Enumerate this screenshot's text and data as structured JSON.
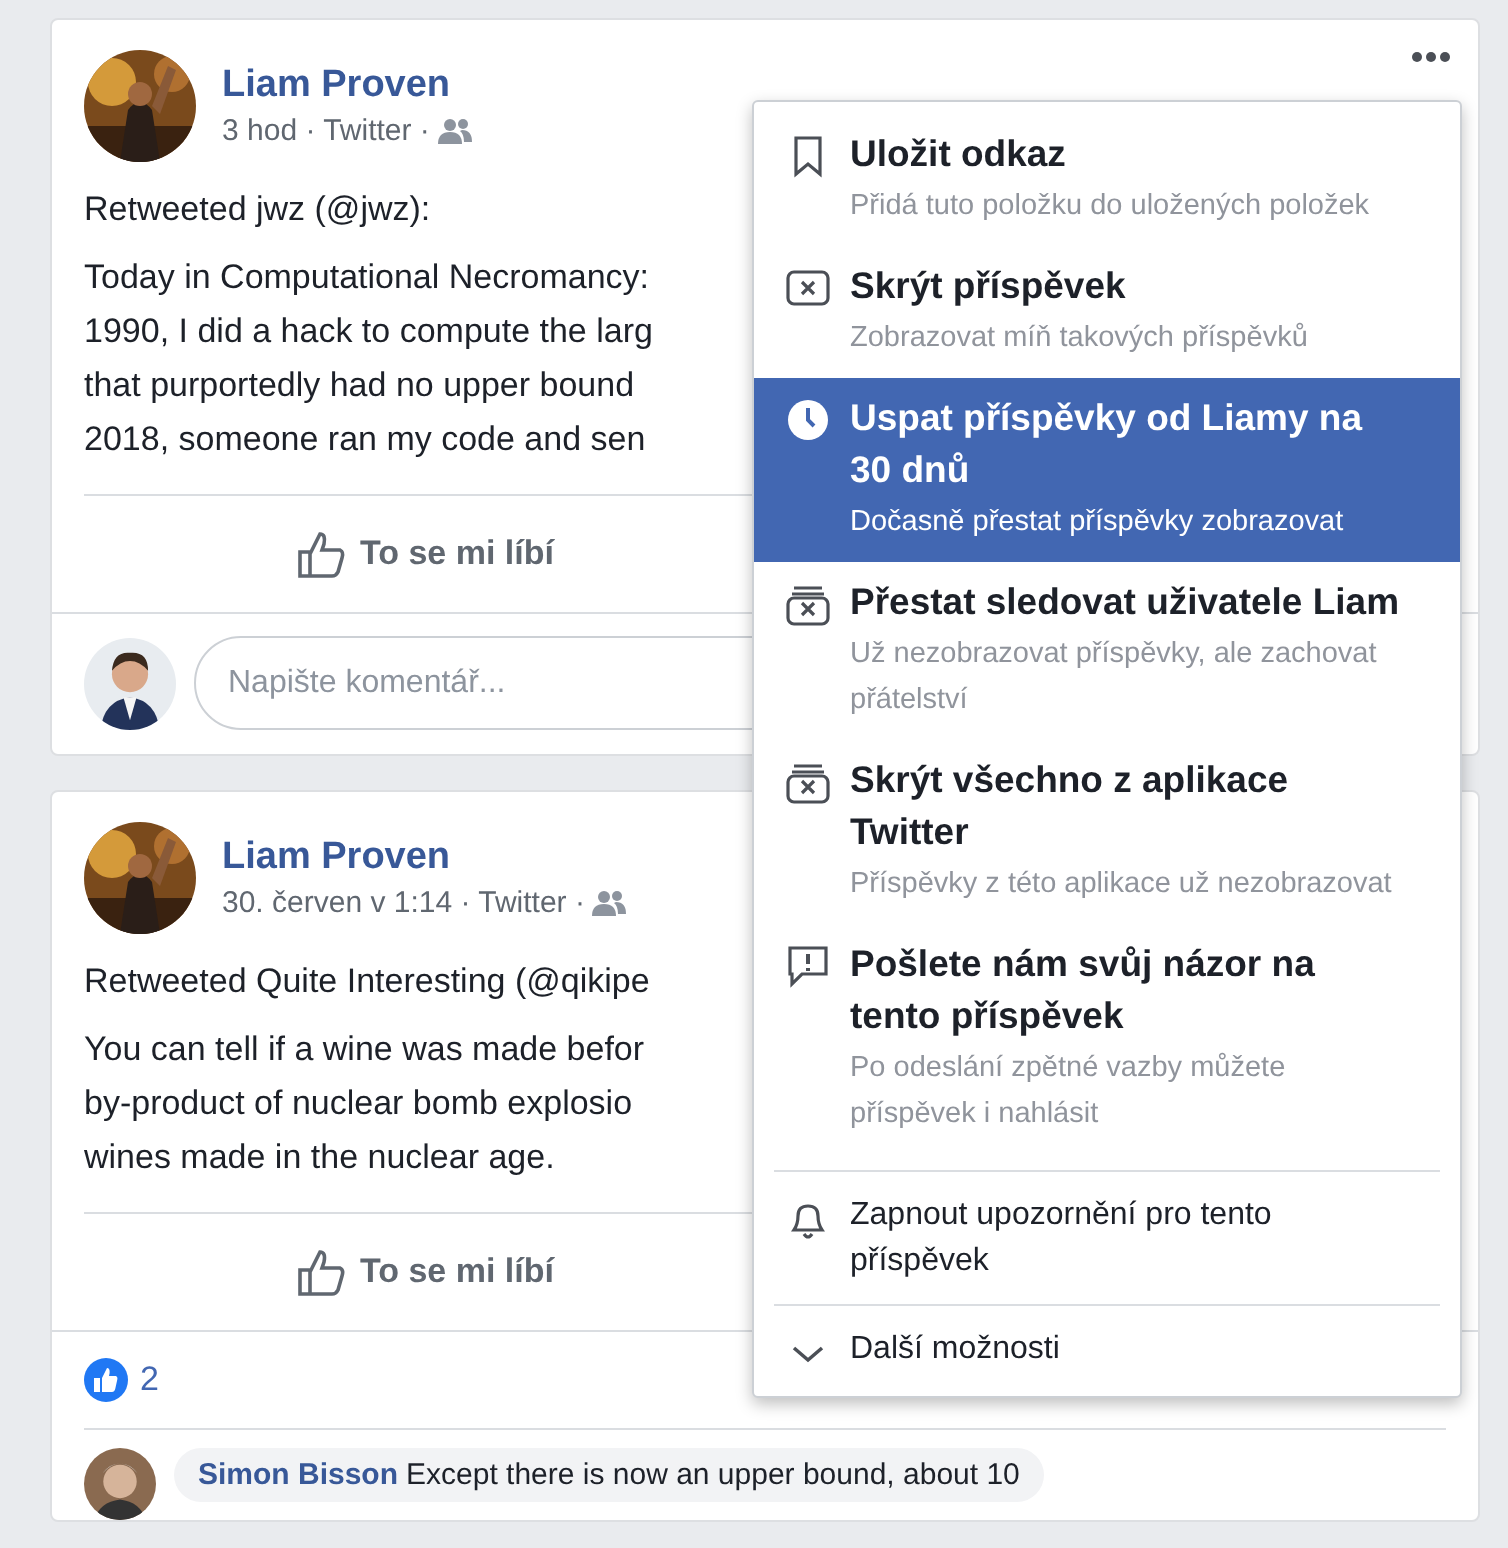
{
  "posts": [
    {
      "author": "Liam Proven",
      "meta": "3 hod · Twitter ·",
      "intro": "Retweeted jwz (@jwz):",
      "body_lines": [
        "Today in Computational Necromancy:",
        "1990, I did a hack to compute the larg",
        "that purportedly had no upper bound",
        "2018, someone ran my code and sen"
      ],
      "like_label": "To se mi líbí",
      "options_button_visible": true,
      "comment_placeholder": "Napište komentář..."
    },
    {
      "author": "Liam Proven",
      "meta": "30. červen v 1:14 · Twitter ·",
      "intro": "Retweeted Quite Interesting (@qikipe",
      "body_lines": [
        "You can tell if a wine was made befor",
        "by-product of nuclear bomb explosio",
        "wines made in the nuclear age."
      ],
      "like_label": "To se mi líbí",
      "reaction_count": "2",
      "comment": {
        "author": "Simon Bisson",
        "text": "Except there is now an upper bound, about 10"
      }
    }
  ],
  "menu": {
    "items": [
      {
        "title": "Uložit odkaz",
        "subtitle": "Přidá tuto položku do uložených položek",
        "selected": false
      },
      {
        "title": "Skrýt příspěvek",
        "subtitle": "Zobrazovat míň takových příspěvků",
        "selected": false
      },
      {
        "title": "Uspat příspěvky od Liamy na 30 dnů",
        "subtitle": "Dočasně přestat příspěvky zobrazovat",
        "selected": true
      },
      {
        "title": "Přestat sledovat uživatele Liam",
        "subtitle": "Už nezobrazovat příspěvky, ale zachovat přátelství",
        "selected": false
      },
      {
        "title": "Skrýt všechno z aplikace Twitter",
        "subtitle": "Příspěvky z této aplikace už nezobrazovat",
        "selected": false
      },
      {
        "title": "Pošlete nám svůj názor na tento příspěvek",
        "subtitle": "Po odeslání zpětné vazby můžete příspěvek i nahlásit",
        "selected": false
      }
    ],
    "notify_label": "Zapnout upozornění pro tento příspěvek",
    "more_label": "Další možnosti"
  }
}
